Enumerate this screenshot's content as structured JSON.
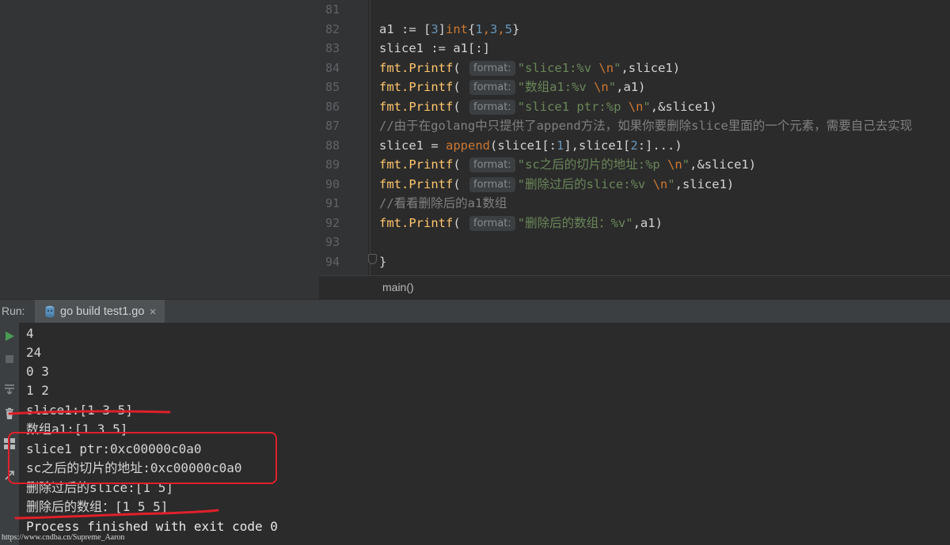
{
  "editor": {
    "line_numbers": [
      "81",
      "82",
      "83",
      "84",
      "85",
      "86",
      "87",
      "88",
      "89",
      "90",
      "91",
      "92",
      "93",
      "94"
    ],
    "hint_label": "format:",
    "lines": {
      "l82": {
        "a": "a1 := [",
        "b": "3",
        "c": "]",
        "d": "int",
        "e": "{",
        "f": "1",
        "g": ",",
        "h": "3",
        "i": ",",
        "j": "5",
        "k": "}"
      },
      "l83": {
        "a": "slice1 := a1[:]"
      },
      "l84": {
        "a": "fmt.",
        "b": "Printf",
        "c": "( ",
        "s1": "\"slice1:%v ",
        "s2": "\\n",
        "s3": "\"",
        "e": ",slice1)"
      },
      "l85": {
        "a": "fmt.",
        "b": "Printf",
        "c": "( ",
        "s1": "\"数组a1:%v ",
        "s2": "\\n",
        "s3": "\"",
        "e": ",a1)"
      },
      "l86": {
        "a": "fmt.",
        "b": "Printf",
        "c": "( ",
        "s1": "\"slice1 ptr:%p ",
        "s2": "\\n",
        "s3": "\"",
        "e": ",&slice1)"
      },
      "l87": {
        "a": "//由于在golang中只提供了append方法，如果你要删除slice里面的一个元素，需要自己去实现"
      },
      "l88": {
        "a": "slice1 = ",
        "b": "append",
        "c": "(slice1[:",
        "d": "1",
        "e": "],slice1[",
        "f": "2",
        "g": ":]...)"
      },
      "l89": {
        "a": "fmt.",
        "b": "Printf",
        "c": "( ",
        "s1": "\"sc之后的切片的地址:%p ",
        "s2": "\\n",
        "s3": "\"",
        "e": ",&slice1)"
      },
      "l90": {
        "a": "fmt.",
        "b": "Printf",
        "c": "( ",
        "s1": "\"删除过后的slice:%v ",
        "s2": "\\n",
        "s3": "\"",
        "e": ",slice1)"
      },
      "l91": {
        "a": "//看看删除后的a1数组"
      },
      "l92": {
        "a": "fmt.",
        "b": "Printf",
        "c": "( ",
        "s1": "\"删除后的数组：%v\"",
        "e": ",a1)"
      },
      "l94": {
        "a": "}"
      }
    },
    "breadcrumb": "main()"
  },
  "run": {
    "label": "Run:",
    "tab_label": "go build test1.go"
  },
  "console": {
    "lines": [
      "4",
      "24",
      "0 3",
      "1 2",
      "slice1:[1 3 5]",
      "数组a1:[1 3 5]",
      "slice1 ptr:0xc00000c0a0",
      "sc之后的切片的地址:0xc00000c0a0",
      "删除过后的slice:[1 5]",
      "删除后的数组：[1 5 5]",
      "Process finished with exit code 0"
    ]
  },
  "watermark": "https://www.cndba.cn/Supreme_Aaron",
  "colors": {
    "editor_bg": "#2b2b2b",
    "panel_bg": "#3c3f41",
    "keyword": "#cc7832",
    "number": "#6897bb",
    "string": "#6a8759",
    "function": "#ffc66d",
    "annotation_red": "#e0202a",
    "run_green": "#499c54"
  }
}
